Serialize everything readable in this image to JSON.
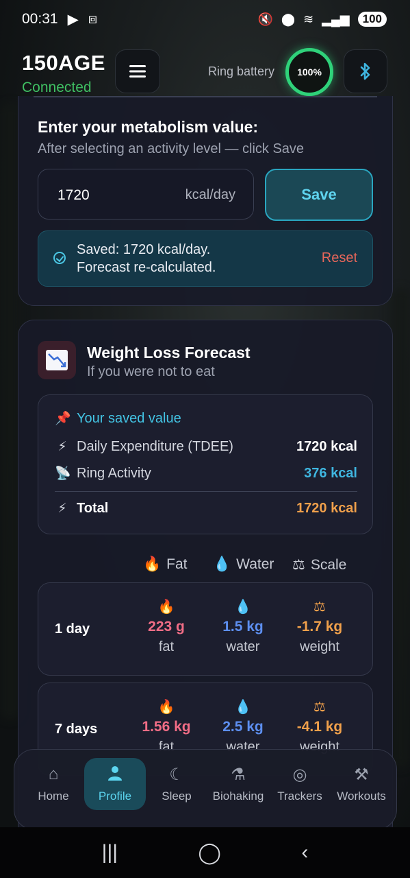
{
  "status_bar": {
    "time": "00:31",
    "battery": "100"
  },
  "header": {
    "app_name": "150AGE",
    "connection_status": "Connected",
    "ring_battery_label": "Ring battery",
    "ring_battery_value": "100%"
  },
  "metabolism_card": {
    "title": "Enter your metabolism value:",
    "subtitle": "After selecting an activity level — click Save",
    "input_value": "1720",
    "input_unit": "kcal/day",
    "save_label": "Save",
    "notice_line1": "Saved: 1720 kcal/day.",
    "notice_line2": "Forecast re-calculated.",
    "reset_label": "Reset"
  },
  "forecast_card": {
    "title": "Weight Loss Forecast",
    "subtitle": "If you were not to eat",
    "saved_value_label": "Your saved value",
    "rows": [
      {
        "emoji": "⚡",
        "label": "Daily Expenditure (TDEE)",
        "value": "1720 kcal"
      },
      {
        "emoji": "📡",
        "label": "Ring Activity",
        "value": "376 kcal"
      }
    ],
    "total": {
      "emoji": "⚡",
      "label": "Total",
      "value": "1720 kcal"
    },
    "legend": {
      "fat": "Fat",
      "water": "Water",
      "scale": "Scale"
    },
    "periods": [
      {
        "label": "1 day",
        "fat": "223 g",
        "water": "1.5 kg",
        "weight": "-1.7 kg"
      },
      {
        "label": "7 days",
        "fat": "1.56 kg",
        "water": "2.5 kg",
        "weight": "-4.1 kg"
      }
    ],
    "captions": {
      "fat": "fat",
      "water": "water",
      "weight": "weight"
    }
  },
  "bottom_nav": {
    "items": [
      {
        "label": "Home",
        "icon": "home-icon"
      },
      {
        "label": "Profile",
        "icon": "person-icon"
      },
      {
        "label": "Sleep",
        "icon": "moon-icon"
      },
      {
        "label": "Biohaking",
        "icon": "microscope-icon"
      },
      {
        "label": "Trackers",
        "icon": "target-icon"
      },
      {
        "label": "Workouts",
        "icon": "dumbbell-icon"
      }
    ],
    "active": "Profile"
  },
  "colors": {
    "accent": "#5cd5f0",
    "connected": "#3fbf62",
    "ring": "#2fd27a",
    "fat": "#f16d86",
    "water": "#5d8ff0",
    "weight": "#f0a04b",
    "reset": "#e7665a"
  }
}
